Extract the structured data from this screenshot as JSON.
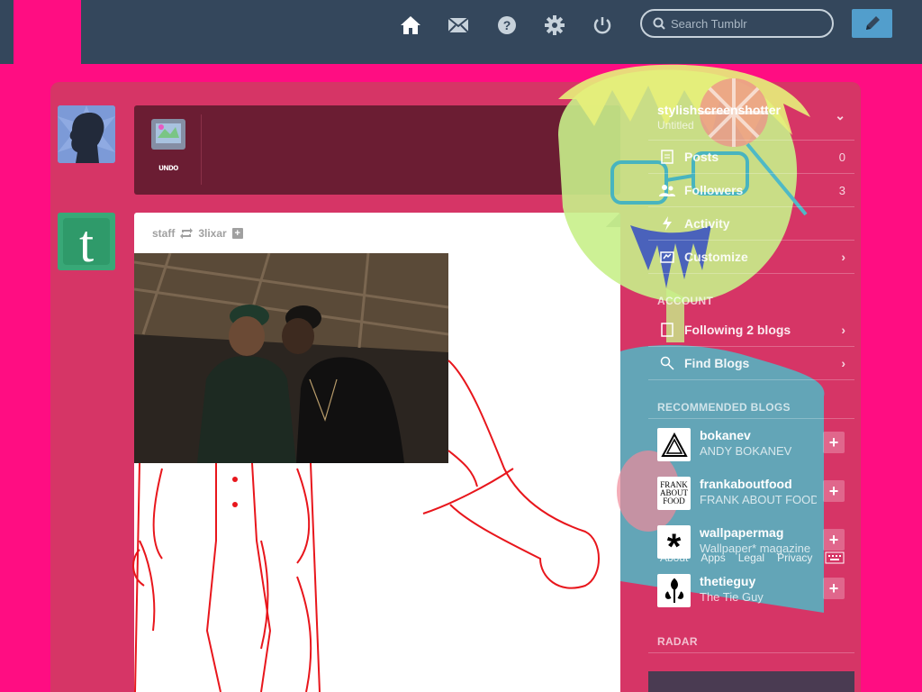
{
  "header": {
    "nav": [
      {
        "name": "home-icon"
      },
      {
        "name": "messages-icon"
      },
      {
        "name": "help-icon"
      },
      {
        "name": "settings-icon"
      },
      {
        "name": "logout-icon"
      }
    ],
    "search_placeholder": "Search Tumblr"
  },
  "post_form": {
    "label": "ᴜɴᴅᴏ"
  },
  "post": {
    "author": "staff",
    "reblogged_from": "3lixar"
  },
  "sidebar": {
    "blog": {
      "name": "stylishscreenshotter",
      "subtitle": "Untitled"
    },
    "rows": [
      {
        "label": "Posts",
        "count": "0"
      },
      {
        "label": "Followers",
        "count": "3"
      },
      {
        "label": "Activity",
        "count": ""
      },
      {
        "label": "Customize",
        "count": ""
      }
    ],
    "account_heading": "ACCOUNT",
    "account_rows": [
      {
        "label": "Following 2 blogs"
      },
      {
        "label": "Find Blogs"
      }
    ],
    "recommended_heading": "RECOMMENDED BLOGS",
    "recommended": [
      {
        "name": "bokanev",
        "title": "ANDY BOKANEV",
        "avatar_text": ""
      },
      {
        "name": "frankaboutfood",
        "title": "FRANK ABOUT FOOD",
        "avatar_text": "FRANK ABOUT FOOD"
      },
      {
        "name": "wallpapermag",
        "title": "Wallpaper* magazine",
        "avatar_text": "*"
      },
      {
        "name": "thetieguy",
        "title": "The Tie Guy",
        "avatar_text": ""
      }
    ],
    "footer_links": [
      "About",
      "Apps",
      "Legal",
      "Privacy"
    ],
    "radar_heading": "RADAR"
  },
  "colors": {
    "background": "#ff0d82",
    "header": "#34475c",
    "dashboard": "#d63566",
    "compose": "#529ecc"
  }
}
